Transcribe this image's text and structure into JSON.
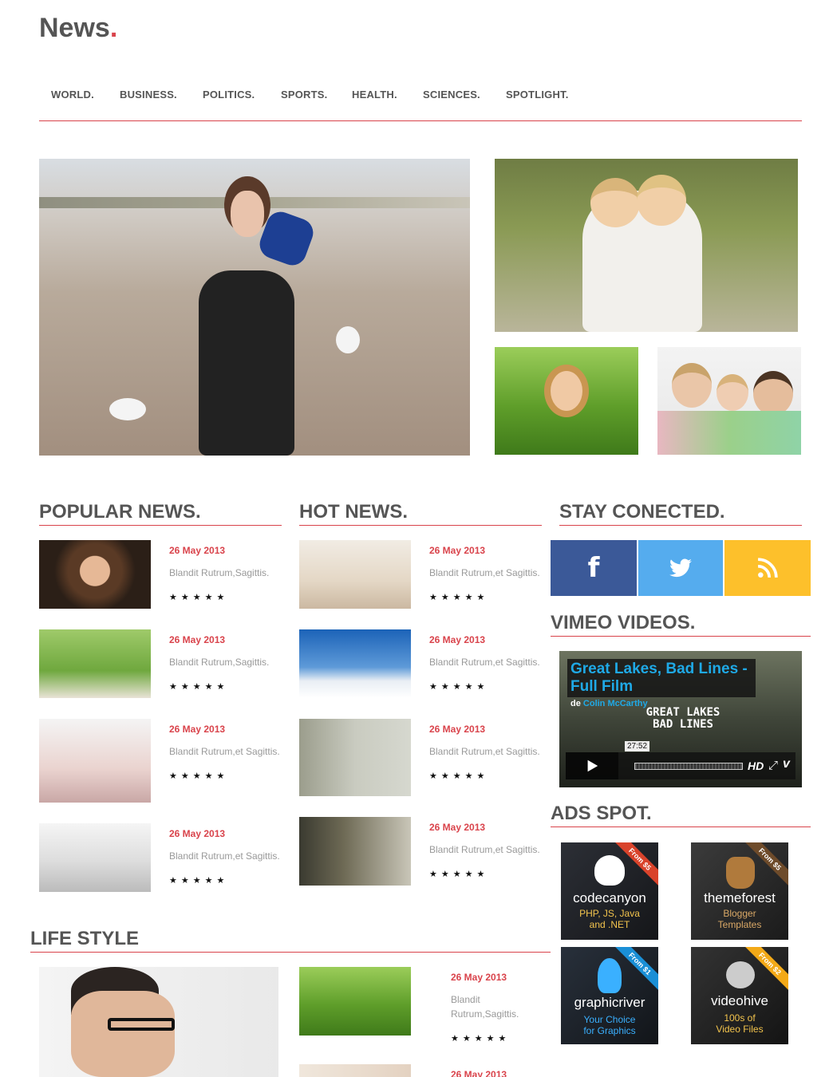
{
  "site": {
    "logo": "News",
    "logo_dot": "."
  },
  "nav": [
    "WORLD.",
    "BUSINESS.",
    "POLITICS.",
    "SPORTS.",
    "HEALTH.",
    "SCIENCES.",
    "SPOTLIGHT."
  ],
  "popular": {
    "title": "POPULAR NEWS.",
    "items": [
      {
        "date": "26 May 2013",
        "desc": "Blandit Rutrum,Sagittis.",
        "stars": "★★★★★"
      },
      {
        "date": "26 May 2013",
        "desc": "Blandit Rutrum,Sagittis.",
        "stars": "★★★★★"
      },
      {
        "date": "26 May 2013",
        "desc": "Blandit Rutrum,et Sagittis.",
        "stars": "★★★★★"
      },
      {
        "date": "26 May 2013",
        "desc": "Blandit Rutrum,et Sagittis.",
        "stars": "★★★★★"
      }
    ]
  },
  "hot": {
    "title": "HOT NEWS.",
    "items": [
      {
        "date": "26 May 2013",
        "desc": "Blandit Rutrum,et Sagittis.",
        "stars": "★★★★★"
      },
      {
        "date": "26 May 2013",
        "desc": "Blandit Rutrum,et Sagittis.",
        "stars": "★★★★★"
      },
      {
        "date": "26 May 2013",
        "desc": "Blandit Rutrum,et Sagittis.",
        "stars": "★★★★★"
      },
      {
        "date": "26 May 2013",
        "desc": "Blandit Rutrum,et Sagittis.",
        "stars": "★★★★★"
      }
    ]
  },
  "stay": {
    "title": "STAY CONECTED.",
    "facebook": {
      "glyph": "f",
      "color": "#3b5998"
    },
    "twitter": {
      "color": "#55acee"
    },
    "rss": {
      "color": "#fdc02b"
    }
  },
  "vimeo": {
    "title": "VIMEO VIDEOS.",
    "video_title": "Great Lakes, Bad Lines - Full Film",
    "by_prefix": "de",
    "author": "Colin McCarthy",
    "overlay_text": "GREAT LAKES BAD LINES",
    "duration": "27:52",
    "hd": "HD"
  },
  "ads": {
    "title": "ADS SPOT.",
    "items": [
      {
        "name": "codecanyon",
        "sub1": "PHP, JS, Java",
        "sub2": "and .NET",
        "ribbon": "From $5",
        "ribbon_color": "#d9432b",
        "sub_color": "#f3c44d"
      },
      {
        "name": "themeforest",
        "sub1": "Blogger",
        "sub2": "Templates",
        "ribbon": "From $5",
        "ribbon_color": "#6e4b2a",
        "sub_color": "#d9a866"
      },
      {
        "name": "graphicriver",
        "sub1": "Your Choice",
        "sub2": "for Graphics",
        "ribbon": "From $1",
        "ribbon_color": "#1a8fd6",
        "sub_color": "#3ab0ff"
      },
      {
        "name": "videohive",
        "sub1": "100s of",
        "sub2": "Video Files",
        "ribbon": "From $2",
        "ribbon_color": "#f3a917",
        "sub_color": "#f3c44d"
      }
    ]
  },
  "lifestyle": {
    "title": "LIFE STYLE",
    "items": [
      {
        "date": "26 May 2013",
        "desc1": "Blandit",
        "desc2": "Rutrum,Sagittis.",
        "stars": "★★★★★"
      },
      {
        "date": "26 May 2013"
      }
    ]
  },
  "colors": {
    "accent": "#d9434b",
    "text": "#555555",
    "muted": "#999999"
  }
}
